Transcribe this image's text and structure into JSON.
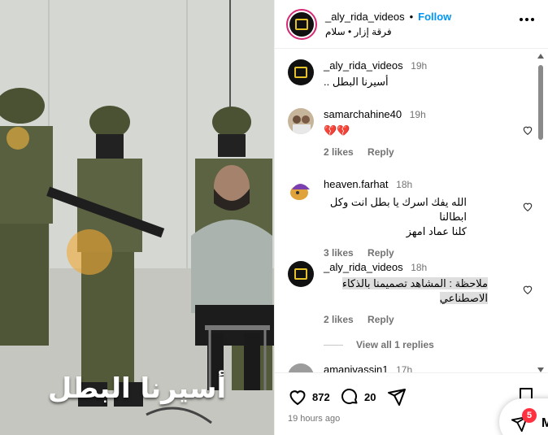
{
  "header": {
    "username": "_aly_rida_videos",
    "separator": "•",
    "follow_label": "Follow",
    "subtitle": "فرقة إزار • سلام"
  },
  "media": {
    "overlay_text": "أسيرنا البطل"
  },
  "comments": [
    {
      "username": "_aly_rida_videos",
      "time": "19h",
      "text": "أسيرنا البطل ..",
      "is_caption": true
    },
    {
      "username": "samarchahine40",
      "time": "19h",
      "text": "💔💔",
      "likes": "2 likes",
      "reply": "Reply"
    },
    {
      "username": "heaven.farhat",
      "time": "18h",
      "text_line1": "الله يفك اسرك يا بطل انت وكل ابطالنا",
      "text_line2": "كلنا عماد امهز",
      "likes": "3 likes",
      "reply": "Reply"
    },
    {
      "username": "_aly_rida_videos",
      "time": "18h",
      "text_line1": "ملاحظة : المشاهد تصميمنا بالذكاء",
      "text_line2": "الاصطناعي",
      "likes": "2 likes",
      "reply": "Reply"
    },
    {
      "username": "amanivassin1",
      "time": "17h"
    }
  ],
  "view_replies": "View all 1 replies",
  "actions": {
    "like_count": "872",
    "comment_count": "20",
    "time_ago": "19 hours ago"
  },
  "messages": {
    "badge": "5",
    "letter": "M"
  },
  "colors": {
    "follow": "#0095f6",
    "badge": "#ff3040",
    "ring": "#d62976"
  }
}
